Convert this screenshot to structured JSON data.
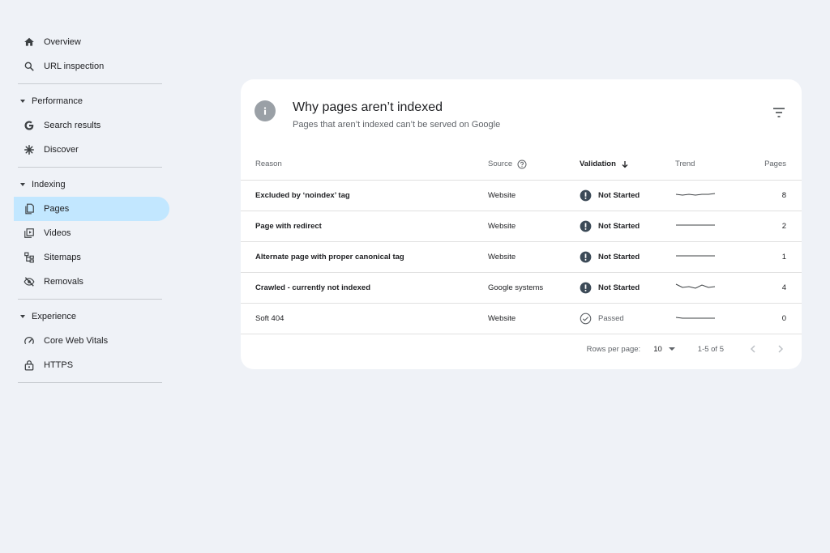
{
  "sidebar": {
    "top_items": [
      {
        "label": "Overview",
        "icon": "home-icon"
      },
      {
        "label": "URL inspection",
        "icon": "search-icon"
      }
    ],
    "sections": [
      {
        "label": "Performance",
        "items": [
          {
            "label": "Search results",
            "icon": "google-g-icon"
          },
          {
            "label": "Discover",
            "icon": "asterisk-icon"
          }
        ]
      },
      {
        "label": "Indexing",
        "items": [
          {
            "label": "Pages",
            "icon": "pages-icon",
            "active": true
          },
          {
            "label": "Videos",
            "icon": "video-icon"
          },
          {
            "label": "Sitemaps",
            "icon": "sitemap-icon"
          },
          {
            "label": "Removals",
            "icon": "eye-off-icon"
          }
        ]
      },
      {
        "label": "Experience",
        "items": [
          {
            "label": "Core Web Vitals",
            "icon": "gauge-icon"
          },
          {
            "label": "HTTPS",
            "icon": "lock-icon"
          }
        ]
      }
    ]
  },
  "card": {
    "title": "Why pages aren’t indexed",
    "subtitle": "Pages that aren’t indexed can’t be served on Google",
    "columns": {
      "reason": "Reason",
      "source": "Source",
      "validation": "Validation",
      "trend": "Trend",
      "pages": "Pages"
    },
    "rows": [
      {
        "reason": "Excluded by ‘noindex’ tag",
        "source": "Website",
        "validation": "Not Started",
        "status": "not-started",
        "trend": [
          5,
          6,
          5,
          6,
          5,
          5,
          4
        ],
        "pages": "8"
      },
      {
        "reason": "Page with redirect",
        "source": "Website",
        "validation": "Not Started",
        "status": "not-started",
        "trend": [
          5,
          5,
          5,
          5,
          5,
          5,
          5
        ],
        "pages": "2"
      },
      {
        "reason": "Alternate page with proper canonical tag",
        "source": "Website",
        "validation": "Not Started",
        "status": "not-started",
        "trend": [
          5,
          5,
          5,
          5,
          5,
          5,
          5
        ],
        "pages": "1"
      },
      {
        "reason": "Crawled - currently not indexed",
        "source": "Google systems",
        "validation": "Not Started",
        "status": "not-started",
        "trend": [
          2,
          6,
          5,
          7,
          3,
          6,
          5
        ],
        "pages": "4"
      },
      {
        "reason": "Soft 404",
        "source": "Website",
        "validation": "Passed",
        "status": "passed",
        "trend": [
          5,
          6,
          6,
          6,
          6,
          6,
          6
        ],
        "pages": "0"
      }
    ],
    "footer": {
      "rows_per_page_label": "Rows per page:",
      "rows_per_page": "10",
      "range": "1-5 of 5"
    }
  },
  "colors": {
    "active_nav": "#c2e7ff",
    "background": "#eff2f7",
    "status_icon": "#3c4a57"
  }
}
